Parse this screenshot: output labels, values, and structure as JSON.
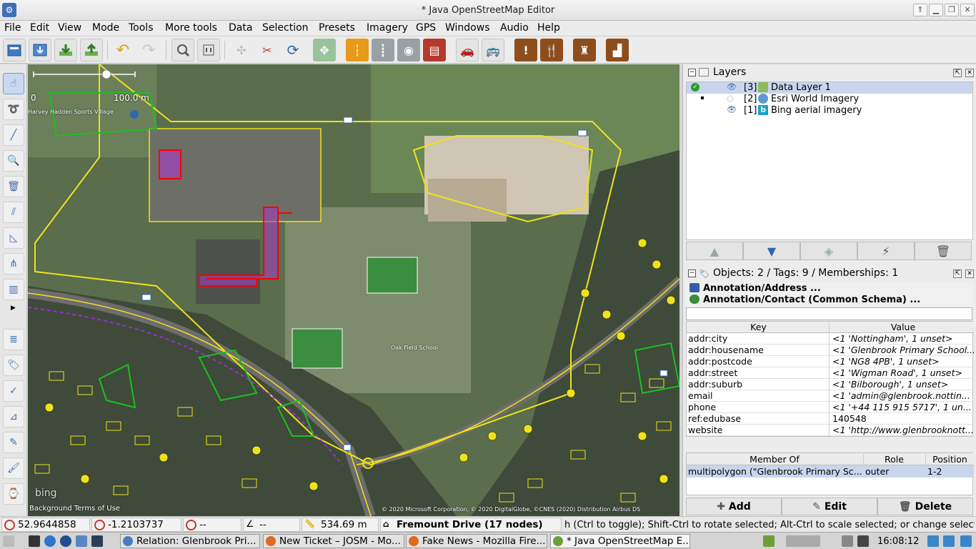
{
  "window": {
    "title": "* Java OpenStreetMap Editor",
    "app_icon": "josm-app-icon"
  },
  "menu": [
    "File",
    "Edit",
    "View",
    "Mode",
    "Tools",
    "More tools",
    "Data",
    "Selection",
    "Presets",
    "Imagery",
    "GPS",
    "Windows",
    "Audio",
    "Help"
  ],
  "toolbar_icons": [
    "open-icon",
    "save-icon",
    "download-icon",
    "upload-icon",
    "undo-icon",
    "redo-icon",
    "preferences-icon",
    "search-icon",
    "merge-nodes-icon",
    "split-way-icon",
    "refresh-icon",
    "aerial-imagery-icon",
    "road-icon",
    "rail-icon",
    "traffic-light-icon",
    "wall-icon",
    "car-icon",
    "bus-icon",
    "warning-icon",
    "restaurant-icon",
    "castle-icon",
    "factory-icon"
  ],
  "left_tools": [
    "select-icon",
    "lasso-icon",
    "draw-icon",
    "zoom-icon",
    "delete-icon",
    "parallel-icon",
    "angle-icon",
    "improve-way-icon",
    "extrude-icon",
    "more-icon",
    "layers-toggle-icon",
    "tags-toggle-icon",
    "validate-icon",
    "filter-icon",
    "measure-icon",
    "map-paint-icon",
    "history-icon"
  ],
  "map": {
    "scale_start": "0",
    "scale_end": "100.0 m",
    "label_school": "Oak Field School",
    "label_sports": "Harvey Hadden Sports Village",
    "attribution_left": "Background Terms of Use",
    "attribution_right": "© 2020 Microsoft Corporation, © 2020 DigitalGlobe, ©CNES (2020) Distribution Airbus DS",
    "bing_logo": "bing"
  },
  "layers": {
    "title": "Layers",
    "items": [
      {
        "num": "[3]",
        "name": "Data Layer 1",
        "selected": true
      },
      {
        "num": "[2]",
        "name": "Esri World Imagery",
        "selected": false
      },
      {
        "num": "[1]",
        "name": "Bing aerial imagery",
        "selected": false
      }
    ]
  },
  "objects": {
    "title": "Objects: 2 / Tags: 9 / Memberships: 1",
    "presets": [
      "Annotation/Address ...",
      "Annotation/Contact (Common Schema) ..."
    ],
    "key_header": "Key",
    "value_header": "Value",
    "tags": [
      {
        "k": "addr:city",
        "v": "<1 'Nottingham', 1 unset>"
      },
      {
        "k": "addr:housename",
        "v": "<1 'Glenbrook Primary School..."
      },
      {
        "k": "addr:postcode",
        "v": "<1 'NG8 4PB', 1 unset>"
      },
      {
        "k": "addr:street",
        "v": "<1 'Wigman Road', 1 unset>"
      },
      {
        "k": "addr:suburb",
        "v": "<1 'Bilborough', 1 unset>"
      },
      {
        "k": "email",
        "v": "<1 'admin@glenbrook.nottin..."
      },
      {
        "k": "phone",
        "v": "<1 '+44 115 915 5717', 1 un..."
      },
      {
        "k": "ref:edubase",
        "v": "140548"
      },
      {
        "k": "website",
        "v": "<1 'http://www.glenbrooknott..."
      }
    ],
    "members_header": {
      "member": "Member Of",
      "role": "Role",
      "position": "Position"
    },
    "members": [
      {
        "member": "multipolygon (\"Glenbrook Primary Sc...",
        "role": "outer",
        "position": "1-2"
      }
    ],
    "add": "Add",
    "edit": "Edit",
    "delete": "Delete"
  },
  "status": {
    "lat": "52.9644858",
    "lon": "-1.2103737",
    "heading": "--",
    "angle": "--",
    "distance": "534.69 m",
    "name": "Fremount Drive (17 nodes)",
    "help": "h (Ctrl to toggle); Shift-Ctrl to rotate selected; Alt-Ctrl to scale selected; or change selection"
  },
  "taskbar": {
    "tasks": [
      {
        "label": "Relation: Glenbrook Pri...",
        "color": "#4a7cc0"
      },
      {
        "label": "New Ticket – JOSM - Mo...",
        "color": "#e06a1c"
      },
      {
        "label": "Fake News - Mozilla Fire...",
        "color": "#e06a1c"
      },
      {
        "label": "* Java OpenStreetMap E...",
        "color": "#6e9e3a"
      }
    ],
    "clock": "16:08:12"
  },
  "colors": {
    "accent": "#3d6fb6",
    "selection": "#c7d6ec",
    "map_way": "#f0e21a",
    "map_selected": "#ff0000"
  }
}
